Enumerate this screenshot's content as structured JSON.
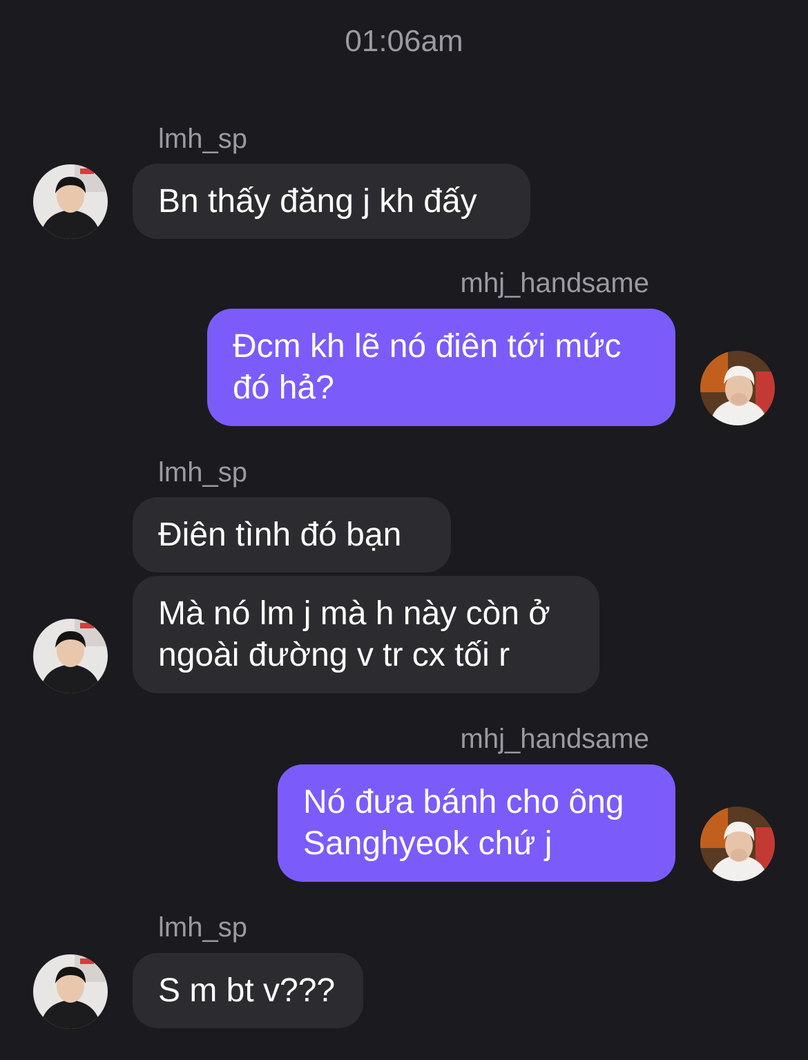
{
  "timestamp": "01:06am",
  "users": {
    "other": {
      "username": "lmh_sp",
      "avatar_icon": "avatar-photo-icon"
    },
    "me": {
      "username": "mhj_handsame",
      "avatar_icon": "avatar-photo-icon"
    }
  },
  "colors": {
    "background": "#1b1a1f",
    "incoming_bubble": "#2c2c30",
    "outgoing_bubble": "#7b5cfb",
    "username_text": "#9a9aa0",
    "message_text": "#ffffff"
  },
  "messages": [
    {
      "sender": "lmh_sp",
      "direction": "incoming",
      "text": "Bn thấy đăng j kh đấy"
    },
    {
      "sender": "mhj_handsame",
      "direction": "outgoing",
      "text": "Đcm kh lẽ nó điên tới mức đó hả?"
    },
    {
      "sender": "lmh_sp",
      "direction": "incoming",
      "text": "Điên tình đó bạn"
    },
    {
      "sender": "lmh_sp",
      "direction": "incoming",
      "text": "Mà nó lm j mà h này còn ở ngoài đường v tr cx tối r"
    },
    {
      "sender": "mhj_handsame",
      "direction": "outgoing",
      "text": "Nó đưa bánh cho ông Sanghyeok chứ j"
    },
    {
      "sender": "lmh_sp",
      "direction": "incoming",
      "text": "S m bt v???"
    }
  ]
}
